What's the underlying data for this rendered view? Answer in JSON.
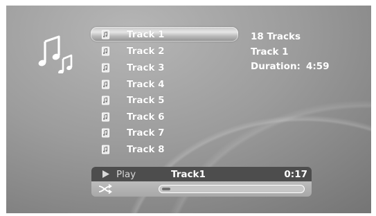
{
  "library": {
    "tracks": [
      {
        "label": "Track 1",
        "selected": true
      },
      {
        "label": "Track 2",
        "selected": false
      },
      {
        "label": "Track 3",
        "selected": false
      },
      {
        "label": "Track 4",
        "selected": false
      },
      {
        "label": "Track 5",
        "selected": false
      },
      {
        "label": "Track 6",
        "selected": false
      },
      {
        "label": "Track 7",
        "selected": false
      },
      {
        "label": "Track 8",
        "selected": false
      }
    ],
    "track_icon": "music-file-icon",
    "header_icon": "music-notes-icon"
  },
  "info": {
    "count": "18 Tracks",
    "current": "Track 1",
    "duration_label": "Duration:",
    "duration_value": "4:59"
  },
  "player": {
    "play_label": "Play",
    "play_icon": "play-icon",
    "now_playing": "Track1",
    "elapsed": "0:17",
    "shuffle_icon": "shuffle-icon",
    "progress_fraction": 0.06
  }
}
